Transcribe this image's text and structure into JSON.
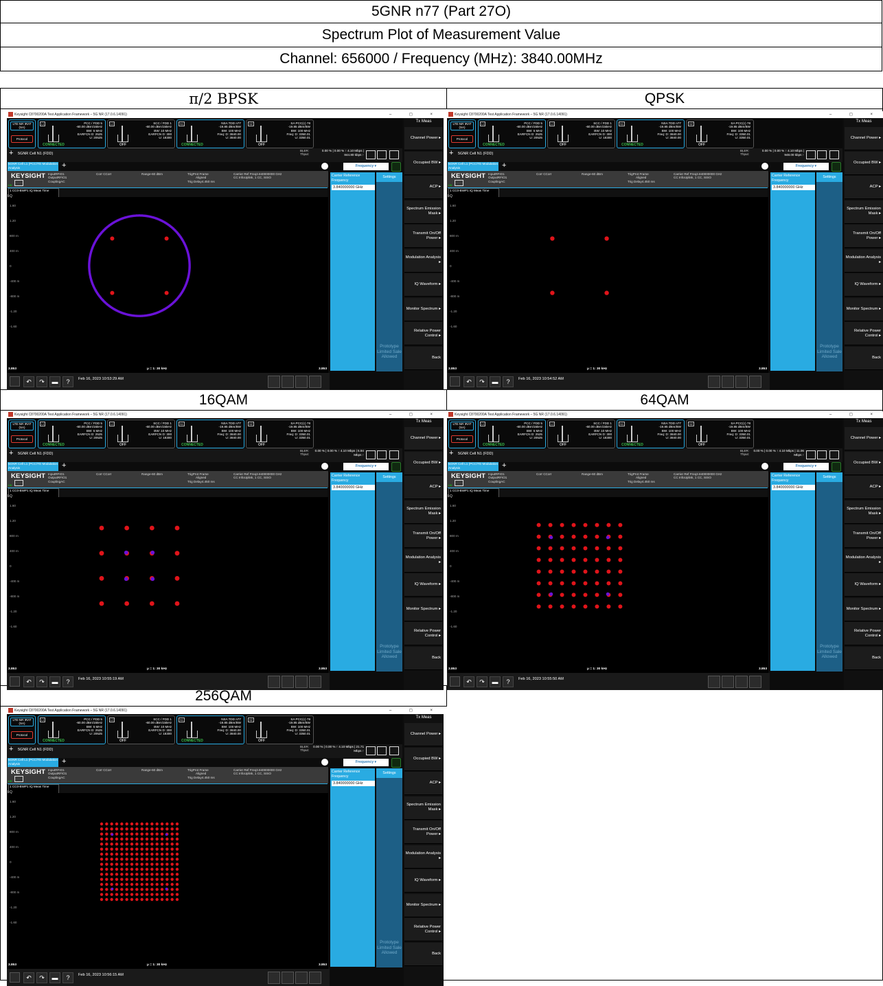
{
  "doc": {
    "title": "5GNR n77 (Part 27O)",
    "subtitle": "Spectrum Plot of Measurement Value",
    "channel": "Channel: 656000 / Frequency (MHz): 3840.00MHz"
  },
  "colors": {
    "accent": "#29abe2",
    "point": "#e0141a",
    "pilot": "#6a12d8",
    "connected": "#3bc14a"
  },
  "app": {
    "title_bar": "Keysight C8700200A Test Application Framework – 5G NR (17.0.6.14091)",
    "window_controls": "– ◻ ×",
    "lte_label": "LTE-NR IRAT (SA)",
    "protocol_button": "Protocol",
    "cards": [
      {
        "tag": "L1",
        "lines": [
          "PCC / FDD 5",
          "-60.00 dBm/15kHz",
          "BW: 5 MHz",
          "EARFCN D: 2525",
          "U: 20525"
        ],
        "status": "CONNECTED",
        "active": true
      },
      {
        "tag": "L2",
        "lines": [
          "SCC / FDD 1",
          "-60.00 dBm/15kHz",
          "BW: 10 MHz",
          "EARFCN D: 300",
          "U: 18300"
        ],
        "status": "OFF",
        "active": false
      },
      {
        "tag": "N1",
        "lines": [
          "NSA TDD n77",
          "-19.85 dBm/BW",
          "BW: 100 MHz",
          "Freq: D: 3840.00",
          "U: 3840.00"
        ],
        "status": "CONNECTED",
        "active": true
      },
      {
        "tag": "N2",
        "lines": [
          "SA PCC(c) 78",
          "-19.85 dBm/BW",
          "BW: 100 MHz",
          "Freq: D: 3350.01",
          "U: 3350.01"
        ],
        "status": "OFF",
        "active": false
      }
    ],
    "cell_name": "5GNR Cell N1 (FDD)",
    "bler_label": "BLER:",
    "thput_label": "Thput:",
    "meas_tab": "5GNR Cell L1 (PCC/TD Modulation Analysis",
    "add_tab": "+",
    "freq_dropdown": "Frequency ▾",
    "logo": "KEYSIGHT",
    "info1": [
      "InputRFIO1",
      "OutputRFIO1",
      "CouplingAC"
    ],
    "info2": "Corr CCorr",
    "info3": "Range-60 dBm",
    "info4": [
      "TrigProt Frame",
      "Aligned",
      "Trig Delay4.450 ms"
    ],
    "info5": [
      "Carrier Ref Freq3.840000000 GHz",
      "CC InfoUplink, 1 CC, SISO"
    ],
    "lxi": "LXI",
    "carrier_ref_label": "Carrier Reference Frequency",
    "carrier_ref_value": "3.840000000 GHz",
    "settings_tab": "Settings",
    "prototype": "Prototype Limited Sale Allowed",
    "cc_dropdown": "1 CC0-BWP1 IQ Meas Time",
    "iq_label": "I-Q",
    "y_ticks": [
      "1.60",
      "1.20",
      "800 m",
      "400 m",
      "0",
      "-400 m",
      "-800 m",
      "-1.20",
      "-1.60"
    ],
    "footer_left": "3.853",
    "footer_mid": "μ = 1: 30 kHz",
    "footer_right": "3.853",
    "menu_header": "Tx Meas",
    "menu_items": [
      "Channel Power ▸",
      "Occupied BW ▸",
      "ACP ▸",
      "Spectrum Emission Mask ▸",
      "Transmit On/Off Power ▸",
      "Modulation Analysis ▸",
      "IQ Waveform ▸",
      "Monitor Spectrum ▸",
      "Relative Power Control ▸",
      "Back"
    ]
  },
  "shots": [
    {
      "label": "π/2 BPSK",
      "thput": "0.00 % | 0.00 % ↑ 4.10 Mbps | 844.80 kbps ↑",
      "date": "Feb 16, 2023 10:53:29 AM",
      "modulation": "pi2bpsk"
    },
    {
      "label": "QPSK",
      "thput": "0.00 % | 0.00 % ↑ 4.10 Mbps | 948.00 kbps ↑",
      "date": "Feb 16, 2023 10:54:52 AM",
      "modulation": "qpsk"
    },
    {
      "label": "16QAM",
      "thput": "0.00 % | 0.00 % ↑ 4.10 Mbps | 5.94 Mbps ↑",
      "date": "Feb 16, 2023 10:55:19 AM",
      "modulation": "16qam"
    },
    {
      "label": "64QAM",
      "thput": "0.00 % | 0.00 % ↑ 4.10 Mbps | 11.06 Mbps ↑",
      "date": "Feb 16, 2023 10:55:50 AM",
      "modulation": "64qam"
    },
    {
      "label": "256QAM",
      "thput": "0.00 % | 0.00 % ↑ 4.10 Mbps | 21.71 Mbps ↑",
      "date": "Feb 16, 2023 10:56:15 AM",
      "modulation": "256qam"
    }
  ]
}
